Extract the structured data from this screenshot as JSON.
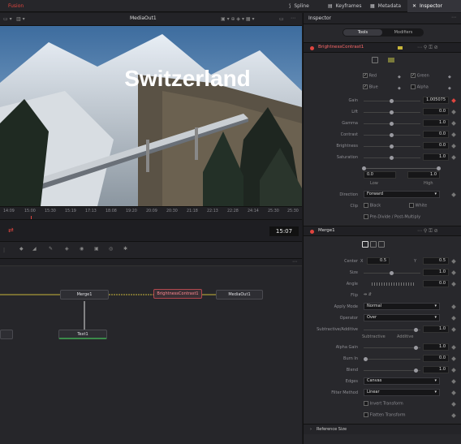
{
  "topbar": {
    "left_tab": "Fusion",
    "tabs": [
      "Spline",
      "Keyframes",
      "Metadata",
      "Inspector"
    ]
  },
  "viewer": {
    "title": "MediaOut1",
    "overlay_text": "Switzerland",
    "ruler_ticks": [
      "14:09",
      "15:00",
      "15:30",
      "15:19",
      "17:13",
      "18:08",
      "19:20",
      "20:09",
      "20:30",
      "21:18",
      "22:13",
      "22:28",
      "24:14",
      "25:30",
      "25:30"
    ],
    "timecode": "15:07"
  },
  "nodes": {
    "merge": "Merge1",
    "bc": "BrightnessContrast1",
    "mediaout": "MediaOut1",
    "text": "Text1"
  },
  "inspector": {
    "title": "Inspector",
    "tab_tools": "Tools",
    "tab_modifiers": "Modifiers",
    "bc": {
      "name": "BrightnessContrast1",
      "red": "Red",
      "green": "Green",
      "blue": "Blue",
      "alpha": "Alpha",
      "gain_label": "Gain",
      "gain": "1.005075",
      "lift_label": "Lift",
      "lift": "0.0",
      "gamma_label": "Gamma",
      "gamma": "1.0",
      "contrast_label": "Contrast",
      "contrast": "0.0",
      "brightness_label": "Brightness",
      "brightness": "0.0",
      "saturation_label": "Saturation",
      "saturation": "1.0",
      "low_val": "0.0",
      "high_val": "1.0",
      "low_label": "Low",
      "high_label": "High",
      "direction_label": "Direction",
      "direction": "Forward",
      "clip_label": "Clip",
      "black": "Black",
      "white": "White",
      "predivide": "Pre-Divide / Post-Multiply"
    },
    "merge": {
      "name": "Merge1",
      "center_label": "Center",
      "x_label": "X",
      "center_x": "0.5",
      "y_label": "Y",
      "center_y": "0.5",
      "size_label": "Size",
      "size": "1.0",
      "angle_label": "Angle",
      "angle": "0.0",
      "flip_label": "Flip",
      "apply_label": "Apply Mode",
      "apply": "Normal",
      "operator_label": "Operator",
      "operator": "Over",
      "subadd_label": "Subtractive/Additive",
      "subadd": "1.0",
      "subtractive": "Subtractive",
      "additive": "Additive",
      "alphagain_label": "Alpha Gain",
      "alphagain": "1.0",
      "burnin_label": "Burn In",
      "burnin": "0.0",
      "blend_label": "Blend",
      "blend": "1.0",
      "edges_label": "Edges",
      "edges": "Canvas",
      "filter_label": "Filter Method",
      "filter": "Linear",
      "invert": "Invert Transform",
      "flatten": "Flatten Transform",
      "reference": "Reference Size"
    }
  },
  "colors": {
    "accent_red": "#e0453f",
    "selection": "#b0474d"
  }
}
